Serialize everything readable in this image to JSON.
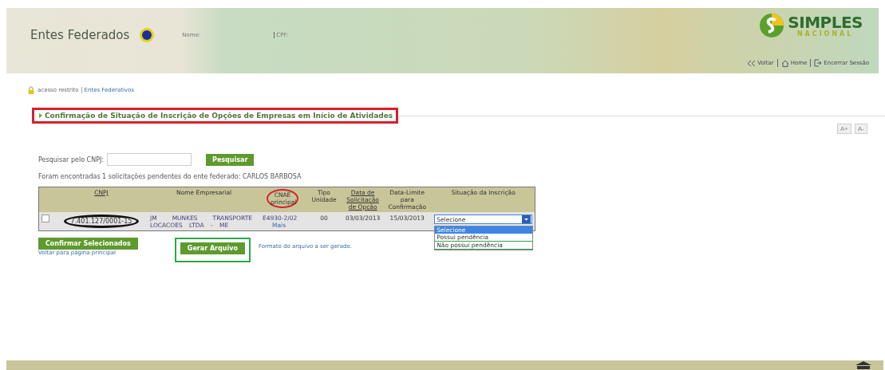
{
  "header": {
    "title": "Entes Federados",
    "nome_label": "Nome:",
    "cpf_label": "CPF:",
    "logo": {
      "word": "SIMPLES",
      "sub": "NACIONAL"
    },
    "nav": [
      {
        "kind": "back",
        "label": "Voltar"
      },
      {
        "kind": "home",
        "label": "Home"
      },
      {
        "kind": "exit",
        "label": "Encerrar Sessão"
      }
    ]
  },
  "breadcrumb": {
    "restricted": "acesso restrito",
    "link": "Entes Federativos"
  },
  "page_title": "Confirmação de Situação de Inscrição de Opções de Empresas em Início de Atividades",
  "font_buttons": [
    "A+",
    "A-"
  ],
  "search": {
    "label": "Pesquisar pelo CNPJ:",
    "button": "Pesquisar"
  },
  "result_message": "Foram encontradas 1 solicitações pendentes do ente federado: CARLOS BARBOSA",
  "table": {
    "columns": [
      {
        "label": "CNPJ",
        "link": true
      },
      {
        "label": "Nome Empresarial",
        "link": false
      },
      {
        "label": "CNAE principal",
        "link": false
      },
      {
        "label": "Tipo Unidade",
        "link": false
      },
      {
        "label": "Data de Solicitação de Opção",
        "link": true
      },
      {
        "label": "Data-Limite para Confirmação",
        "link": false
      },
      {
        "label": "Situação da Inscrição",
        "link": false
      }
    ],
    "rows": [
      {
        "checked": false,
        "cnpj": "7.401.127/0001-15",
        "nome": "JM MUNKES TRANSPORTE LOCACOES LTDA - ME",
        "cnae": "E4930-2/02",
        "cnae_more": "Mais",
        "tipo": "00",
        "data_solicitacao": "03/03/2013",
        "data_limite": "15/03/2013",
        "situacao": "Selecione",
        "dropdown": {
          "expanded": true,
          "options": [
            {
              "label": "Selecione",
              "selected": true
            },
            {
              "label": "Possui pendência",
              "selected": false
            },
            {
              "label": "Não possui pendência",
              "selected": false
            }
          ]
        }
      }
    ]
  },
  "actions": {
    "confirm": "Confirmar Selecionados",
    "back_link": "Voltar para página principal",
    "generate": "Gerar Arquivo",
    "format_link": "Formato do arquivo a ser gerado."
  }
}
